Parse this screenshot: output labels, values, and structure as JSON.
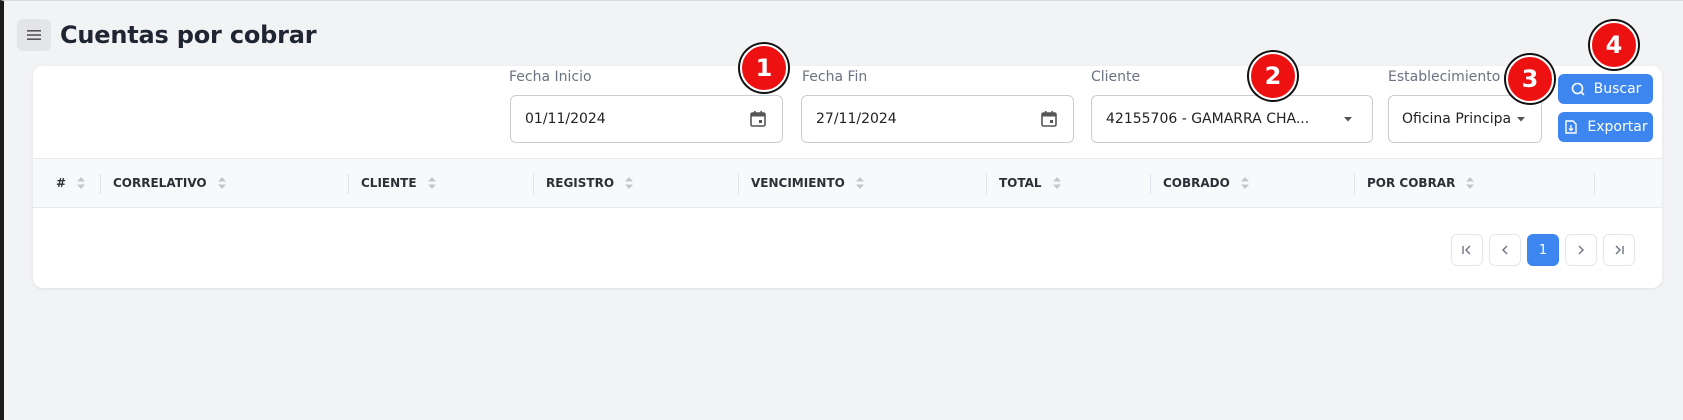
{
  "header": {
    "title": "Cuentas por cobrar",
    "menu_icon": "hamburger-icon"
  },
  "filters": {
    "fecha_inicio": {
      "label": "Fecha Inicio",
      "value": "01/11/2024",
      "icon": "calendar-icon"
    },
    "fecha_fin": {
      "label": "Fecha Fin",
      "value": "27/11/2024",
      "icon": "calendar-icon"
    },
    "cliente": {
      "label": "Cliente",
      "value": "42155706 - GAMARRA CHA...",
      "icon": "caret-down-icon"
    },
    "establecimiento": {
      "label": "Establecimiento",
      "value": "Oficina Principal",
      "icon": "caret-down-icon"
    }
  },
  "actions": {
    "buscar": {
      "label": "Buscar",
      "icon": "search-icon"
    },
    "exportar": {
      "label": "Exportar",
      "icon": "export-file-icon"
    }
  },
  "table": {
    "columns": [
      "#",
      "CORRELATIVO",
      "CLIENTE",
      "REGISTRO",
      "VENCIMIENTO",
      "TOTAL",
      "COBRADO",
      "POR COBRAR"
    ],
    "rows": []
  },
  "pagination": {
    "current_page": "1"
  },
  "markers": [
    "1",
    "2",
    "3",
    "4"
  ],
  "colors": {
    "accent": "#3d86f0",
    "marker": "#ee1111",
    "background": "#f2f3f5"
  }
}
